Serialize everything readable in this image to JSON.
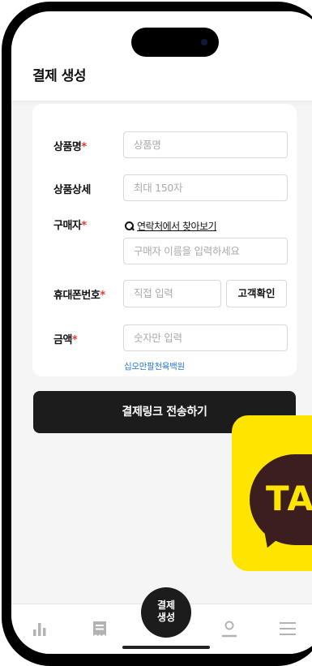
{
  "header": {
    "title": "결제 생성"
  },
  "form": {
    "product_name": {
      "label": "상품명",
      "required_mark": "*",
      "placeholder": "상품명"
    },
    "product_detail": {
      "label": "상품상세",
      "placeholder": "최대 150자"
    },
    "buyer": {
      "label": "구매자",
      "required_mark": "*",
      "contacts_link": "연락처에서 찾아보기",
      "placeholder": "구매자 이름을 입력하세요"
    },
    "phone": {
      "label": "휴대폰번호",
      "required_mark": "*",
      "placeholder": "직접 입력",
      "verify_button": "고객확인"
    },
    "amount": {
      "label": "금액",
      "required_mark": "*",
      "placeholder": "숫자만 입력",
      "amount_in_korean": "십오만팔천육백원"
    }
  },
  "send_button": {
    "label": "결제링크 전송하기"
  },
  "kakao_overlay": {
    "text": "TA",
    "color": "#FEE500",
    "icon": "kakaotalk-icon"
  },
  "bottom_nav": {
    "items": [
      {
        "icon": "bar-chart-icon"
      },
      {
        "icon": "receipt-icon"
      },
      {
        "label_line1": "결제",
        "label_line2": "생성"
      },
      {
        "icon": "person-icon"
      },
      {
        "icon": "menu-icon"
      }
    ]
  },
  "colors": {
    "accent": "#1c1c1c",
    "required": "#e53935",
    "link_blue": "#2a7ad6",
    "nav_icon": "#b3b3b3"
  }
}
